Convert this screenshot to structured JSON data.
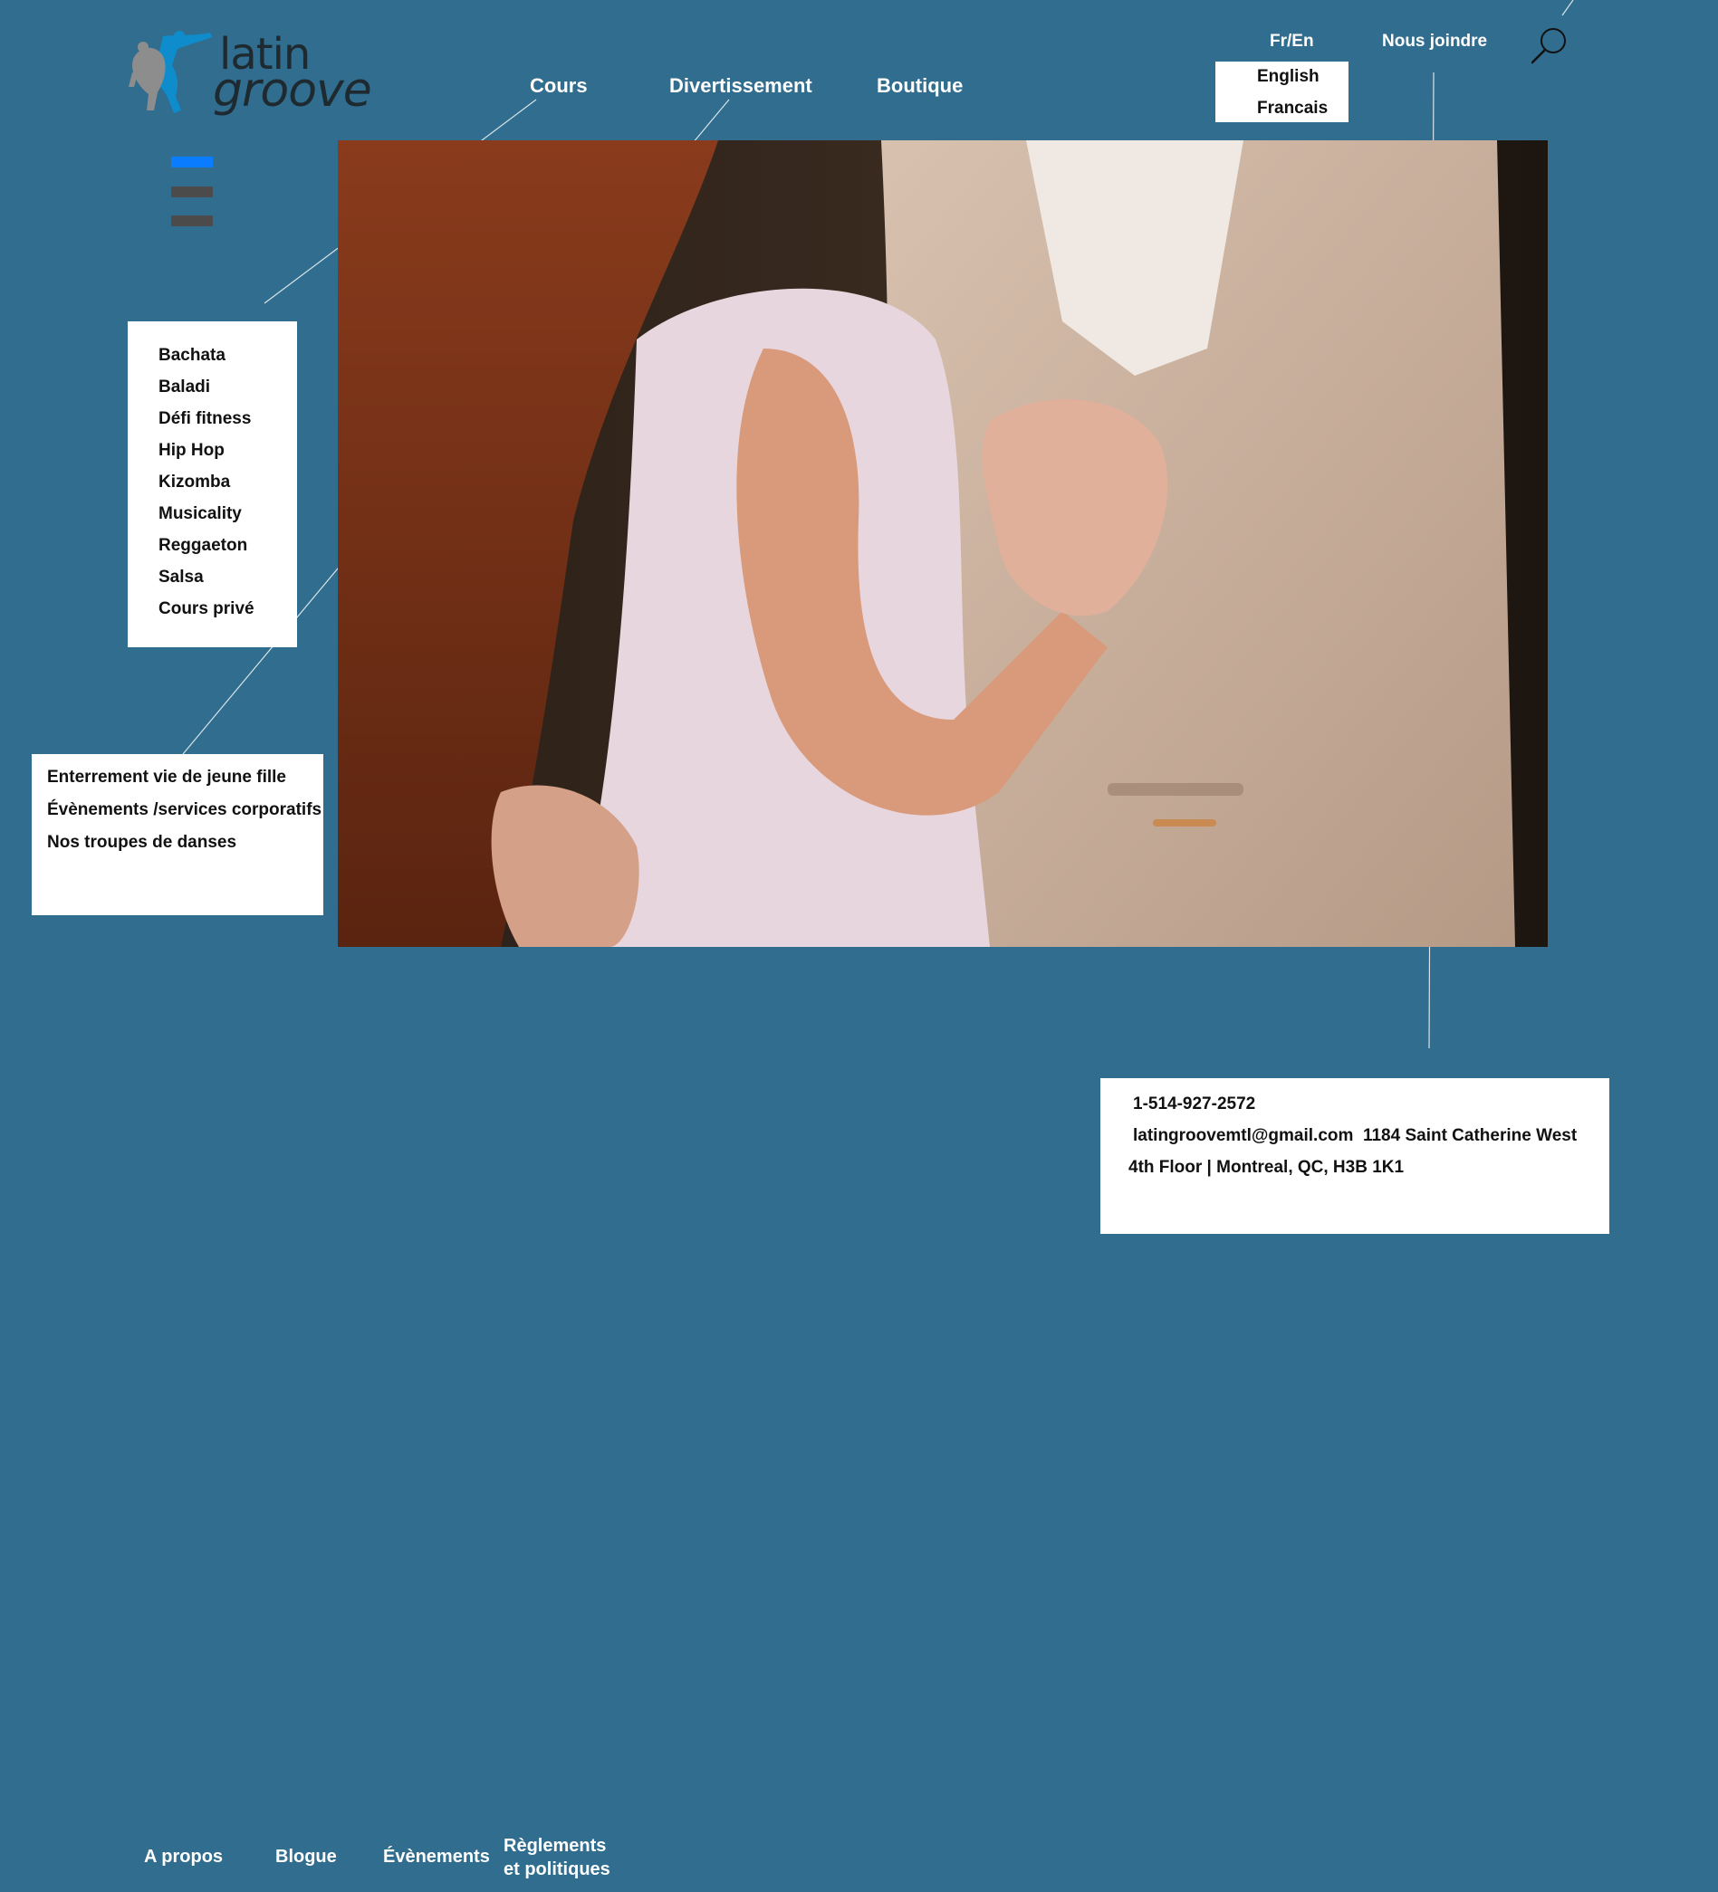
{
  "logo": {
    "line1": "latin",
    "line2": "groove"
  },
  "nav": {
    "cours": "Cours",
    "divertissement": "Divertissement",
    "boutique": "Boutique"
  },
  "top": {
    "lang_toggle": "Fr/En",
    "contact": "Nous joindre"
  },
  "language_menu": {
    "items": [
      "English",
      "Francais"
    ]
  },
  "hamburger": {
    "active_color": "#0a7cff",
    "bar_color": "#4b4b4b"
  },
  "cours_menu": {
    "items": [
      "Bachata",
      "Baladi",
      "Défi fitness",
      "Hip Hop",
      "Kizomba",
      "Musicality",
      "Reggaeton",
      "Salsa",
      "Cours privé"
    ]
  },
  "divertissement_menu": {
    "items": [
      "Enterrement vie de jeune fille",
      "Évènements /services corporatifs",
      "Nos troupes de danses"
    ]
  },
  "contact_panel": {
    "phone": "1-514-927-2572",
    "email_address": "latingroovemtl@gmail.com  1184 Saint Catherine West",
    "address_line2": "4th Floor | Montreal, QC, H3B 1K1"
  },
  "footer": {
    "apropos": "A propos",
    "blogue": "Blogue",
    "evenements": "Évènements",
    "reglements_1": "Règlements",
    "reglements_2": "et politiques"
  },
  "colors": {
    "background": "#316d8e",
    "panel": "#ffffff",
    "text_dark": "#111111",
    "accent": "#0a7cff"
  }
}
